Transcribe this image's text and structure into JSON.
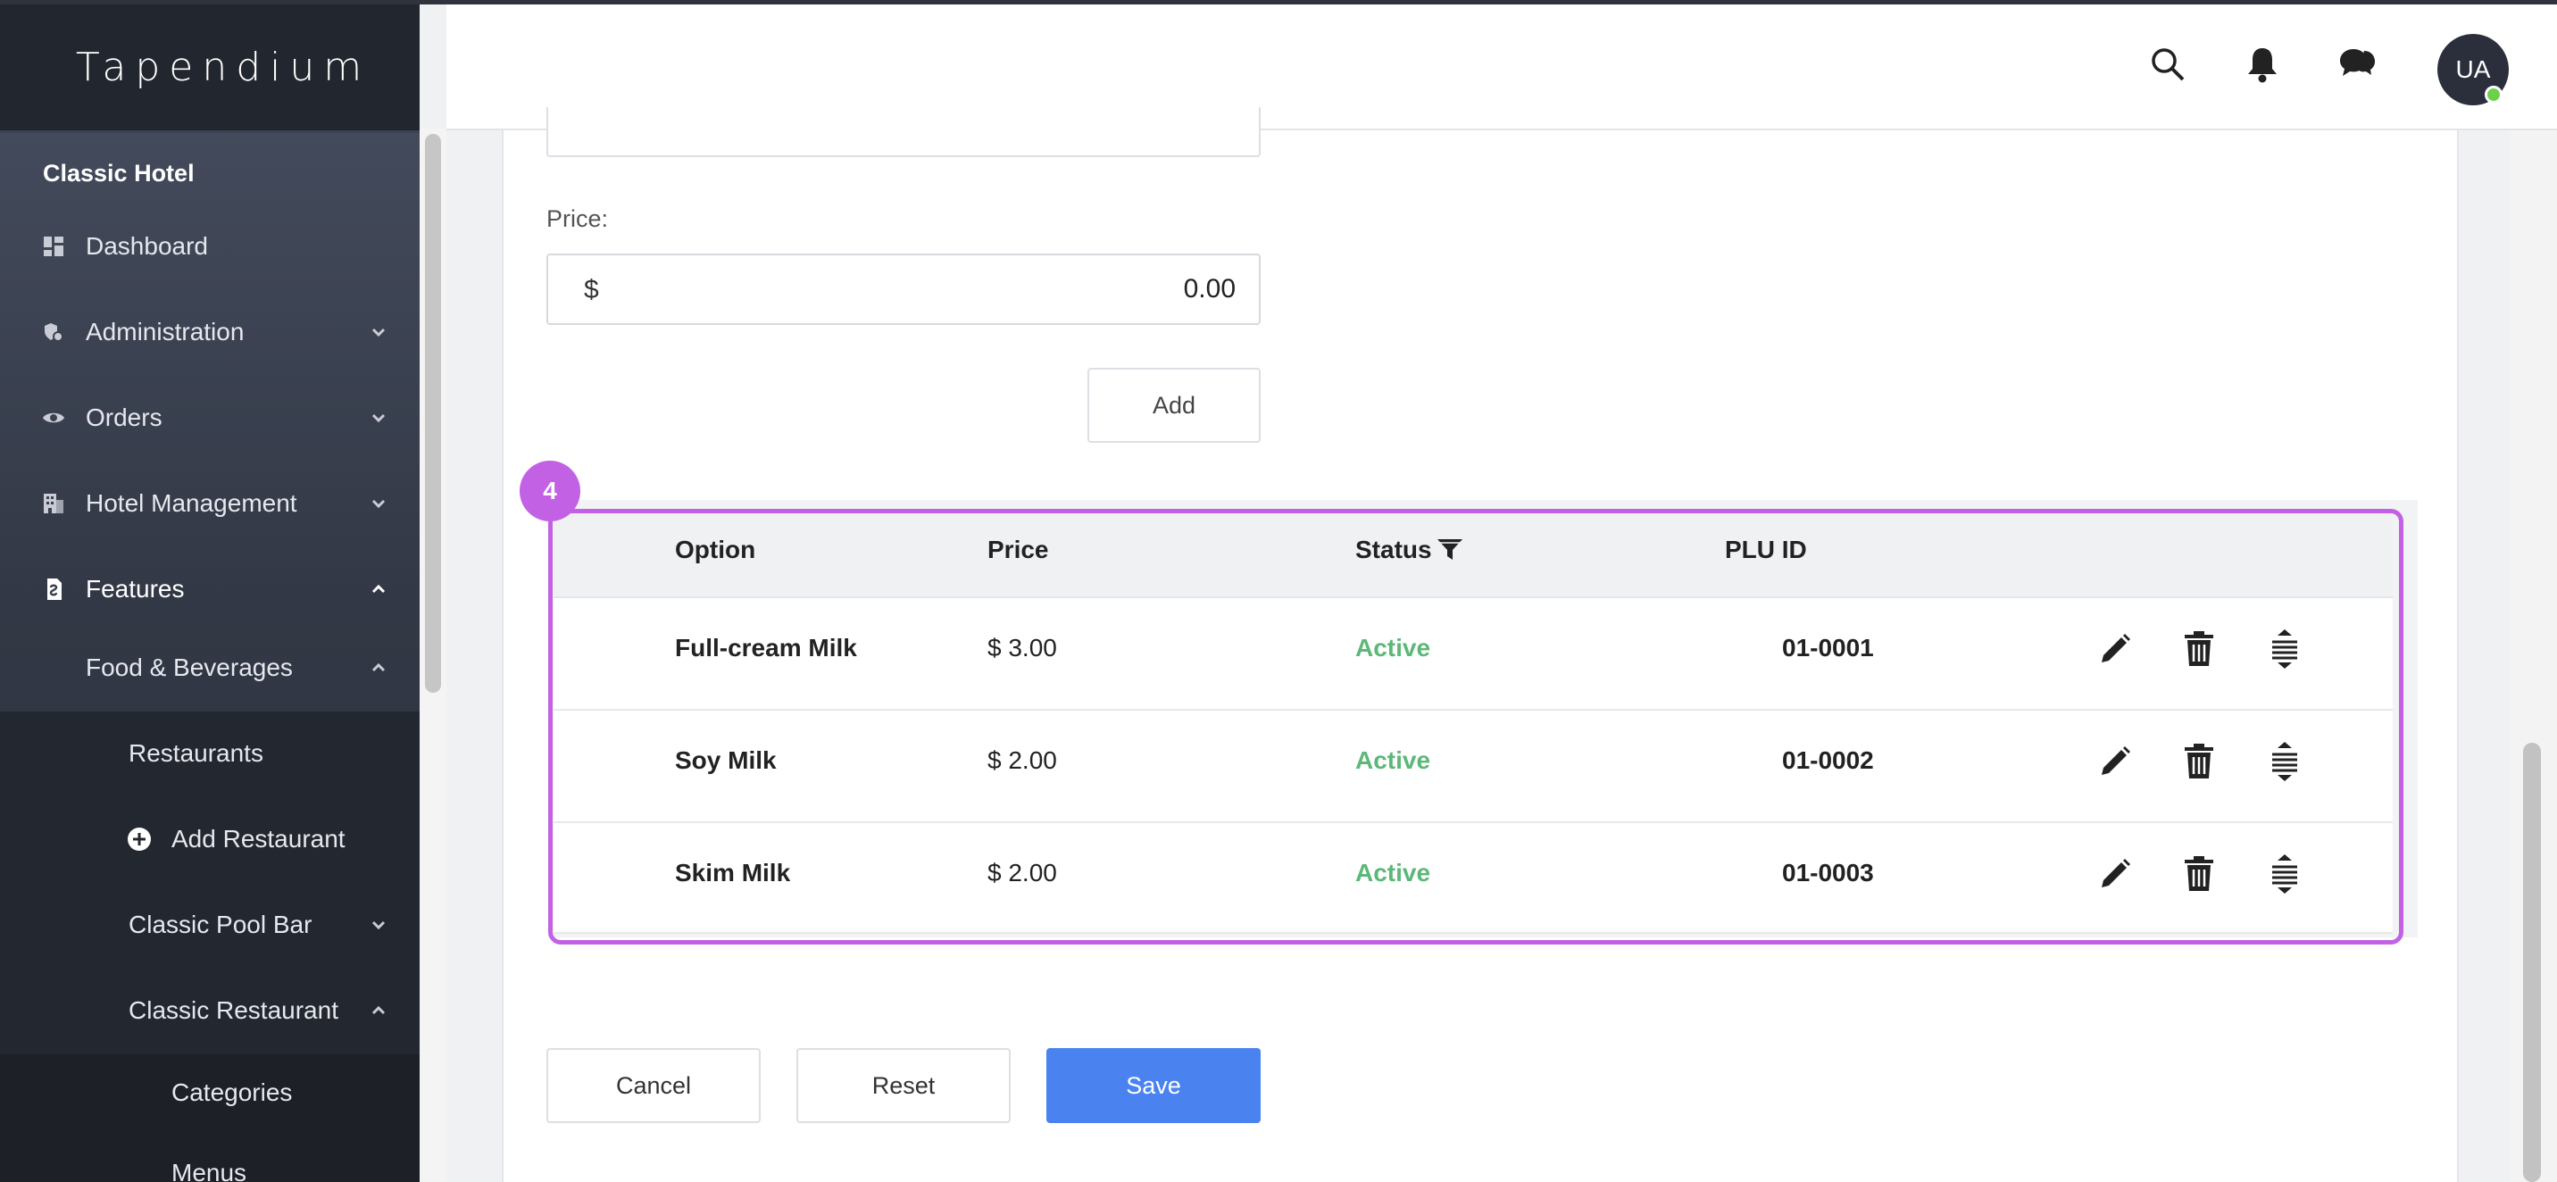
{
  "app": {
    "brand": "Tapendium"
  },
  "sidebar": {
    "hotel_name": "Classic Hotel",
    "items": [
      {
        "label": "Dashboard",
        "icon": "dashboard-icon"
      },
      {
        "label": "Administration",
        "icon": "admin-icon",
        "chevron": "down"
      },
      {
        "label": "Orders",
        "icon": "eye-icon",
        "chevron": "down"
      },
      {
        "label": "Hotel Management",
        "icon": "building-icon",
        "chevron": "down"
      },
      {
        "label": "Features",
        "icon": "features-icon",
        "chevron": "up"
      },
      {
        "label": "Food & Beverages",
        "chevron": "up"
      },
      {
        "label": "Restaurants"
      },
      {
        "label": "Add Restaurant",
        "icon": "plus-circle-icon"
      },
      {
        "label": "Classic Pool Bar",
        "chevron": "down"
      },
      {
        "label": "Classic Restaurant",
        "chevron": "up"
      },
      {
        "label": "Categories"
      },
      {
        "label": "Menus"
      }
    ]
  },
  "header": {
    "icons": [
      "search-icon",
      "bell-icon",
      "chat-icon"
    ],
    "avatar_initials": "UA",
    "status_color": "#6dd04b"
  },
  "form": {
    "price_label": "Price:",
    "currency_symbol": "$",
    "price_value": "0.00",
    "add_label": "Add"
  },
  "table": {
    "badge_number": "4",
    "headers": {
      "option": "Option",
      "price": "Price",
      "status": "Status",
      "plu": "PLU ID"
    },
    "rows": [
      {
        "option": "Full-cream Milk",
        "price": "$ 3.00",
        "status": "Active",
        "plu": "01-0001"
      },
      {
        "option": "Soy Milk",
        "price": "$ 2.00",
        "status": "Active",
        "plu": "01-0002"
      },
      {
        "option": "Skim Milk",
        "price": "$ 2.00",
        "status": "Active",
        "plu": "01-0003"
      }
    ],
    "row_actions": [
      "edit-icon",
      "delete-icon",
      "reorder-icon"
    ]
  },
  "footer": {
    "cancel_label": "Cancel",
    "reset_label": "Reset",
    "save_label": "Save"
  },
  "colors": {
    "accent": "#4a83f0",
    "highlight": "#c361e4",
    "active_status": "#5cb878",
    "sidebar_bg": "#2b2f3b"
  }
}
